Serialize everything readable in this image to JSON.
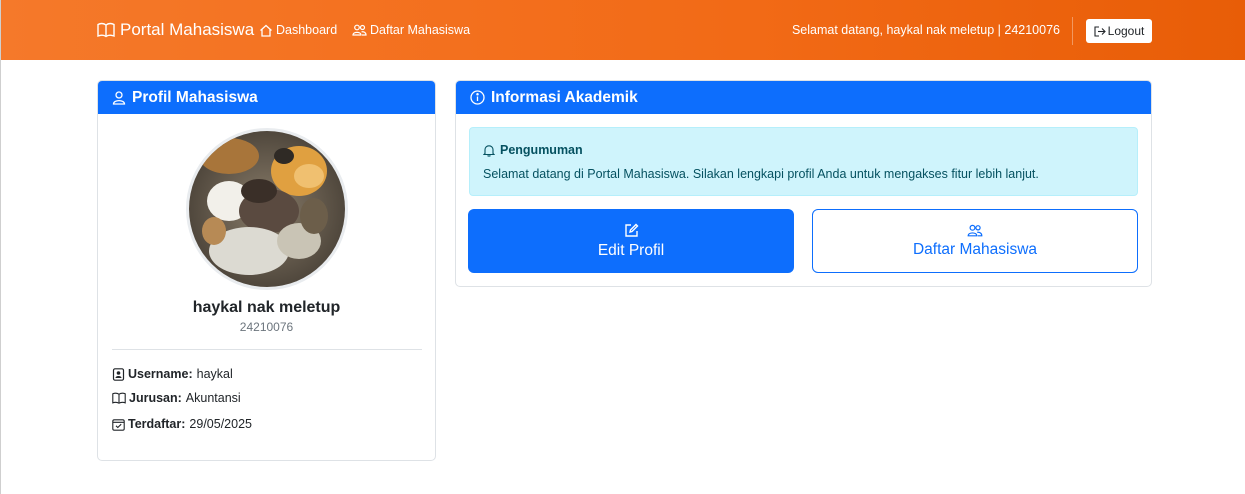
{
  "navbar": {
    "brand": "Portal Mahasiswa",
    "links": [
      {
        "label": "Dashboard",
        "icon": "house-icon"
      },
      {
        "label": "Daftar Mahasiswa",
        "icon": "people-icon"
      }
    ],
    "welcome": "Selamat datang, haykal nak meletup | 24210076",
    "logout_label": "Logout"
  },
  "profile": {
    "header": "Profil Mahasiswa",
    "name": "haykal nak meletup",
    "nim": "24210076",
    "details": [
      {
        "label": "Username:",
        "value": "haykal",
        "icon": "person-badge-icon"
      },
      {
        "label": "Jurusan:",
        "value": "Akuntansi",
        "icon": "book-icon"
      },
      {
        "label": "Terdaftar:",
        "value": "29/05/2025",
        "icon": "calendar-check-icon"
      }
    ]
  },
  "akademik": {
    "header": "Informasi Akademik",
    "announcement": {
      "title": "Pengumuman",
      "text": "Selamat datang di Portal Mahasiswa. Silakan lengkapi profil Anda untuk mengakses fitur lebih lanjut."
    },
    "buttons": [
      {
        "label": "Edit Profil",
        "icon": "pencil-square-icon"
      },
      {
        "label": "Daftar Mahasiswa",
        "icon": "people-icon"
      }
    ]
  },
  "colors": {
    "navbar_start": "#f5792a",
    "navbar_end": "#e85d07",
    "primary": "#0d6efd",
    "alert_bg": "#cff4fc",
    "alert_text": "#055160"
  }
}
